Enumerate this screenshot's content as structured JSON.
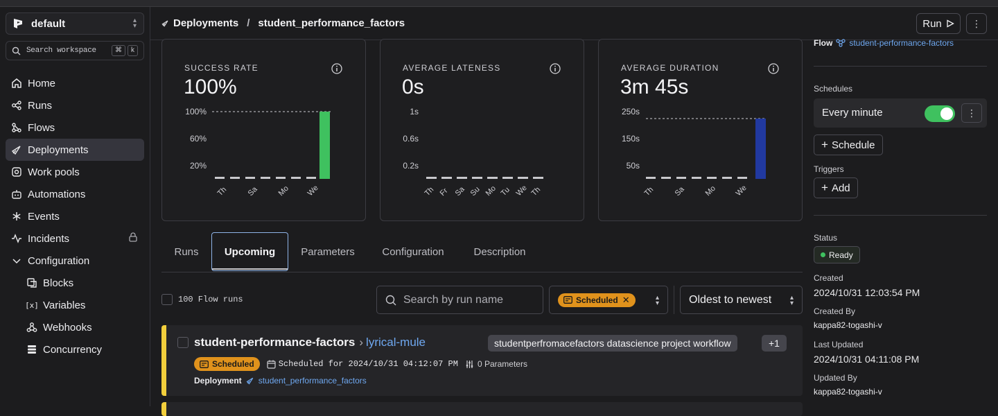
{
  "workspace": {
    "name": "default"
  },
  "search": {
    "placeholder": "Search workspace",
    "shortcut_mod": "⌘",
    "shortcut_key": "k"
  },
  "nav": {
    "home": "Home",
    "runs": "Runs",
    "flows": "Flows",
    "deployments": "Deployments",
    "work_pools": "Work pools",
    "automations": "Automations",
    "events": "Events",
    "incidents": "Incidents",
    "configuration": "Configuration",
    "blocks": "Blocks",
    "variables": "Variables",
    "webhooks": "Webhooks",
    "concurrency": "Concurrency"
  },
  "header": {
    "crumb_root": "Deployments",
    "crumb_current": "student_performance_factors",
    "run_label": "Run"
  },
  "stats": [
    {
      "label": "SUCCESS RATE",
      "value": "100%",
      "y_ticks": [
        "100%",
        "60%",
        "20%"
      ],
      "x_ticks": [
        "Th",
        "Sa",
        "Mo",
        "We"
      ]
    },
    {
      "label": "AVERAGE LATENESS",
      "value": "0s",
      "y_ticks": [
        "1s",
        "0.6s",
        "0.2s"
      ],
      "x_ticks": [
        "Th",
        "Fr",
        "Sa",
        "Su",
        "Mo",
        "Tu",
        "We",
        "Th"
      ]
    },
    {
      "label": "AVERAGE DURATION",
      "value": "3m 45s",
      "y_ticks": [
        "250s",
        "150s",
        "50s"
      ],
      "x_ticks": [
        "Th",
        "Sa",
        "Mo",
        "We"
      ]
    }
  ],
  "colors": {
    "success": "#3fc15f",
    "duration": "#2139a0",
    "scheduled": "#e0921c",
    "link": "#6fa8f0",
    "accent_border": "#f2cf3c"
  },
  "tabs": [
    "Runs",
    "Upcoming",
    "Parameters",
    "Configuration",
    "Description"
  ],
  "filters": {
    "count_label": "100 Flow runs",
    "search_placeholder": "Search by run name",
    "state_chip": "Scheduled",
    "sort": "Oldest to newest"
  },
  "run": {
    "flow": "student-performance-factors",
    "name": "lyrical-mule",
    "tag": "studentperfromacefactors datascience project workflow",
    "tag_more": "+1",
    "state": "Scheduled",
    "scheduled_for": "Scheduled for 2024/10/31 04:12:07 PM",
    "params": "0 Parameters",
    "deployment_label": "Deployment",
    "deployment": "student_performance_factors"
  },
  "panel": {
    "flow_label": "Flow",
    "flow_name": "student-performance-factors",
    "schedules_label": "Schedules",
    "schedule": "Every minute",
    "add_schedule": "Schedule",
    "triggers_label": "Triggers",
    "add_trigger": "Add",
    "status_label": "Status",
    "status": "Ready",
    "created_label": "Created",
    "created": "2024/10/31 12:03:54 PM",
    "created_by_label": "Created By",
    "created_by": "kappa82-togashi-v",
    "updated_label": "Last Updated",
    "updated": "2024/10/31 04:11:08 PM",
    "updated_by_label": "Updated By",
    "updated_by": "kappa82-togashi-v"
  }
}
